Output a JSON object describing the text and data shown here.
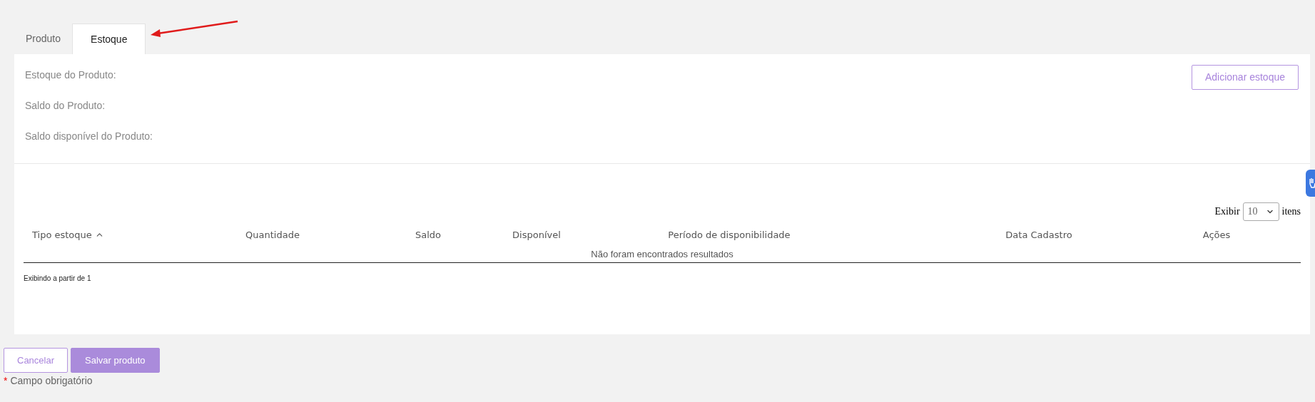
{
  "tabs": [
    {
      "label": "Produto",
      "selected": false
    },
    {
      "label": "Estoque",
      "selected": true
    }
  ],
  "stock_info": [
    "Estoque do Produto:",
    "Saldo do Produto:",
    "Saldo disponível do Produto:"
  ],
  "add_button": "Adicionar estoque",
  "page_size": {
    "prefix": "Exibir",
    "value": "10",
    "suffix": "itens"
  },
  "table": {
    "columns": [
      {
        "label": "Tipo estoque",
        "sorted": true
      },
      {
        "label": "Quantidade",
        "sorted": false
      },
      {
        "label": "Saldo",
        "sorted": false
      },
      {
        "label": "Disponível",
        "sorted": false
      },
      {
        "label": "Período de disponibilidade",
        "sorted": false
      },
      {
        "label": "Data Cadastro",
        "sorted": false
      },
      {
        "label": "Ações",
        "sorted": false
      }
    ],
    "empty_message": "Não foram encontrados resultados",
    "footer": "Exibindo a partir de 1"
  },
  "buttons": [
    {
      "label": "Cancelar",
      "kind": "secondary"
    },
    {
      "label": "Salvar produto",
      "kind": "primary"
    }
  ],
  "required_note": {
    "marker": "*",
    "text": "Campo obrigatório"
  }
}
